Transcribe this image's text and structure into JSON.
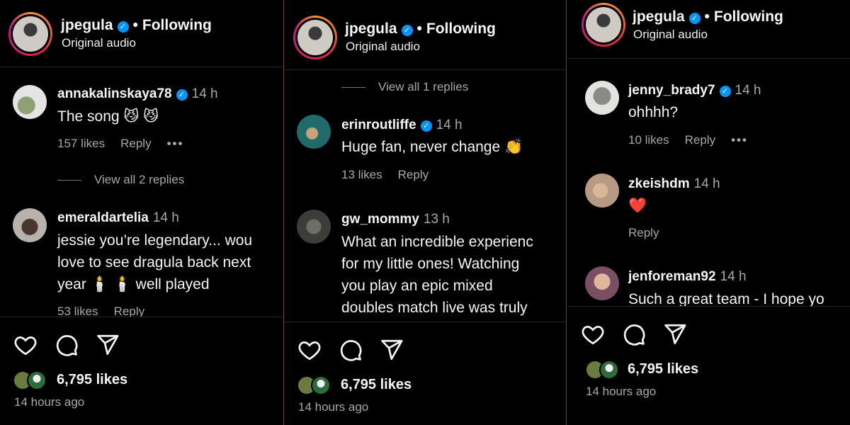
{
  "header": {
    "username": "jpegula",
    "follow_status": "Following",
    "audio": "Original audio"
  },
  "panel1": {
    "comments": [
      {
        "username": "annakalinskaya78",
        "time": "14 h",
        "text": "The song 😼 😼",
        "likes": "157 likes",
        "reply": "Reply",
        "more": "•••"
      },
      {
        "username": "emeraldartelia",
        "time": "14 h",
        "text_lines": [
          "jessie you’re legendary... wou",
          "love to see dragula back next",
          "year 🕯️ 🕯️ well played"
        ],
        "likes": "53 likes",
        "reply": "Reply"
      }
    ],
    "view_replies": "View all 2 replies"
  },
  "panel2": {
    "view_replies": "View all 1 replies",
    "comments": [
      {
        "username": "erinroutliffe",
        "time": "14 h",
        "text": "Huge fan, never change 👏",
        "likes": "13 likes",
        "reply": "Reply"
      },
      {
        "username": "gw_mommy",
        "time": "13 h",
        "text_lines": [
          "What an incredible experienc",
          "for my little ones! Watching",
          "you play an epic mixed",
          "doubles match live was truly"
        ]
      }
    ]
  },
  "panel3": {
    "comments": [
      {
        "username": "jenny_brady7",
        "time": "14 h",
        "text": "ohhhh?",
        "likes": "10 likes",
        "reply": "Reply",
        "more": "•••"
      },
      {
        "username": "zkeishdm",
        "time": "14 h",
        "text": "❤️",
        "reply": "Reply"
      },
      {
        "username": "jenforeman92",
        "time": "14 h",
        "text": "Such a great team - I hope yo"
      }
    ]
  },
  "post": {
    "likes": "6,795 likes",
    "time_ago": "14 hours ago"
  },
  "colors": {
    "verified": "#0095f6",
    "muted": "#a8a8a8",
    "background": "#000000",
    "divider": "#262626"
  }
}
